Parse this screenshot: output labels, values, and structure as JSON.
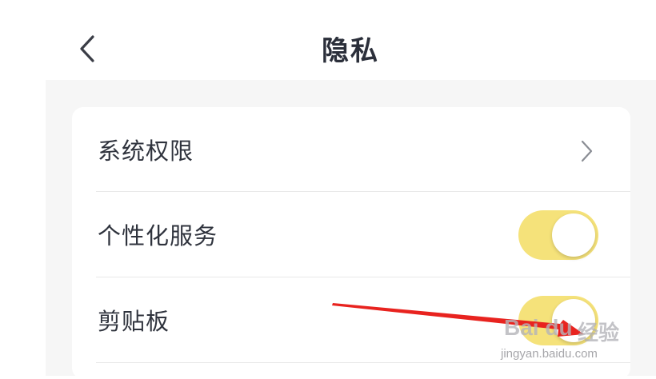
{
  "header": {
    "title": "隐私",
    "back_icon": "chevron-left-icon"
  },
  "settings": {
    "rows": [
      {
        "label": "系统权限",
        "control": "chevron-right-icon"
      },
      {
        "label": "个性化服务",
        "control": "toggle",
        "on": true
      },
      {
        "label": "剪贴板",
        "control": "toggle",
        "on": true
      }
    ]
  },
  "colors": {
    "toggle_on": "#f5e27a",
    "background": "#f6f6f6",
    "annotation_arrow": "#e8231f"
  },
  "watermark": {
    "logo": "Bai du",
    "logo_cn": "经验",
    "url": "jingyan.baidu.com"
  }
}
